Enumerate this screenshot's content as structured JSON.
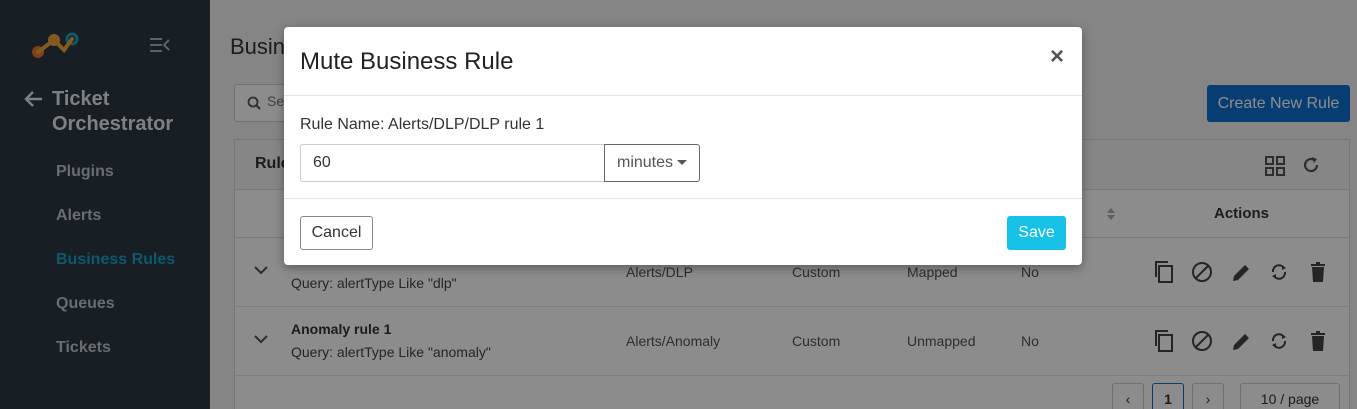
{
  "sidebar": {
    "app_title_line1": "Ticket",
    "app_title_line2": "Orchestrator",
    "items": [
      {
        "label": "Plugins"
      },
      {
        "label": "Alerts"
      },
      {
        "label": "Business Rules"
      },
      {
        "label": "Queues"
      },
      {
        "label": "Tickets"
      }
    ],
    "active_color": "#18a3c4"
  },
  "main": {
    "page_title": "Busin",
    "search_placeholder": "Sea",
    "create_button": "Create New Rule",
    "card_title": "Rule",
    "actions_header": "Actions",
    "rows": [
      {
        "name": "",
        "query": "Query: alertType Like \"dlp\"",
        "c1": "Alerts/DLP",
        "c2": "Custom",
        "c3": "Mapped",
        "c4": "No"
      },
      {
        "name": "Anomaly rule 1",
        "query": "Query: alertType Like \"anomaly\"",
        "c1": "Alerts/Anomaly",
        "c2": "Custom",
        "c3": "Unmapped",
        "c4": "No"
      }
    ],
    "pager": {
      "current": "1",
      "page_size": "10 / page"
    }
  },
  "modal": {
    "title": "Mute Business Rule",
    "close_symbol": "×",
    "rule_label": "Rule Name: Alerts/DLP/DLP rule 1",
    "duration_value": "60",
    "unit": "minutes",
    "cancel_label": "Cancel",
    "save_label": "Save"
  },
  "colors": {
    "sidebar_bg": "#2b3743",
    "primary_button": "#0d6fcf",
    "save_button": "#17c1e8"
  }
}
